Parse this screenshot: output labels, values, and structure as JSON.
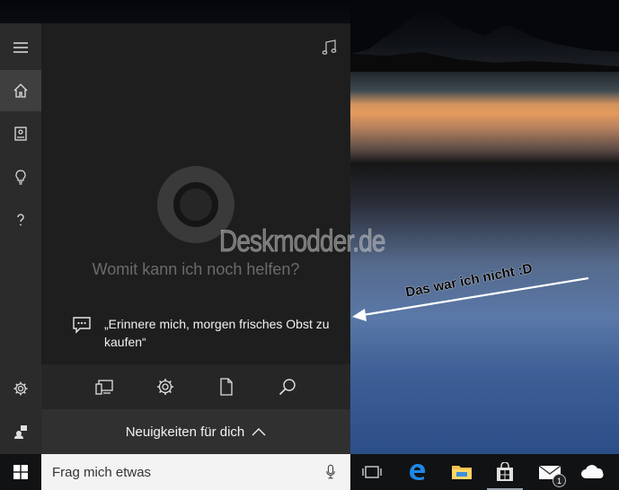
{
  "panel": {
    "prompt": "Womit kann ich noch helfen?",
    "suggestion": "„Erinnere mich, morgen frisches Obst zu kaufen“",
    "news_label": "Neuigkeiten für dich"
  },
  "sidebar": {
    "items": [
      {
        "name": "menu",
        "icon": "hamburger-icon"
      },
      {
        "name": "home",
        "icon": "home-icon",
        "active": true
      },
      {
        "name": "notebook",
        "icon": "notebook-icon"
      },
      {
        "name": "reminders",
        "icon": "lightbulb-icon"
      },
      {
        "name": "help",
        "icon": "question-icon"
      },
      {
        "name": "settings",
        "icon": "gear-icon"
      },
      {
        "name": "feedback",
        "icon": "feedback-icon"
      }
    ]
  },
  "quickbar": {
    "icons": [
      "devices-icon",
      "gear-icon",
      "document-icon",
      "search-icon"
    ]
  },
  "taskbar": {
    "search_placeholder": "Frag mich etwas",
    "mail_badge": "1",
    "apps": [
      "task-view-icon",
      "edge-icon",
      "file-explorer-icon",
      "store-icon",
      "mail-icon",
      "onedrive-icon"
    ]
  },
  "annotation": {
    "text": "Das war ich nicht :D"
  },
  "watermark": {
    "text": "Deskmodder.de"
  },
  "colors": {
    "panel_bg": "#1e1e1e",
    "sidebar_bg": "#2b2b2b",
    "accent": "#0078d7"
  }
}
